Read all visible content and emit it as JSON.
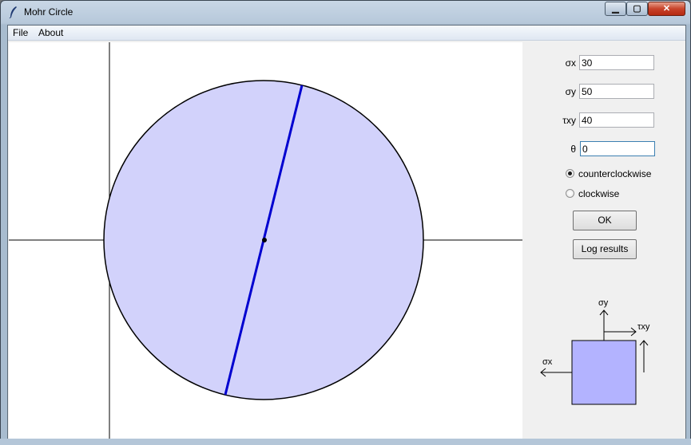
{
  "window": {
    "title": "Mohr Circle"
  },
  "menu": {
    "items": [
      "File",
      "About"
    ]
  },
  "inputs": {
    "sigma_x": {
      "label": "σx",
      "value": "30"
    },
    "sigma_y": {
      "label": "σy",
      "value": "50"
    },
    "tau_xy": {
      "label": "τxy",
      "value": "40"
    },
    "theta": {
      "label": "θ",
      "value": "0"
    }
  },
  "rotation": {
    "options": [
      "counterclockwise",
      "clockwise"
    ],
    "selected": "counterclockwise"
  },
  "buttons": {
    "ok": "OK",
    "log": "Log results"
  },
  "element_diagram": {
    "sigma_y": "σy",
    "tau_xy": "τxy",
    "sigma_x": "σx",
    "fill_color": "#b3b3ff"
  },
  "circle": {
    "fill_color": "#d2d2fb",
    "diameter_color": "#0000d0"
  }
}
